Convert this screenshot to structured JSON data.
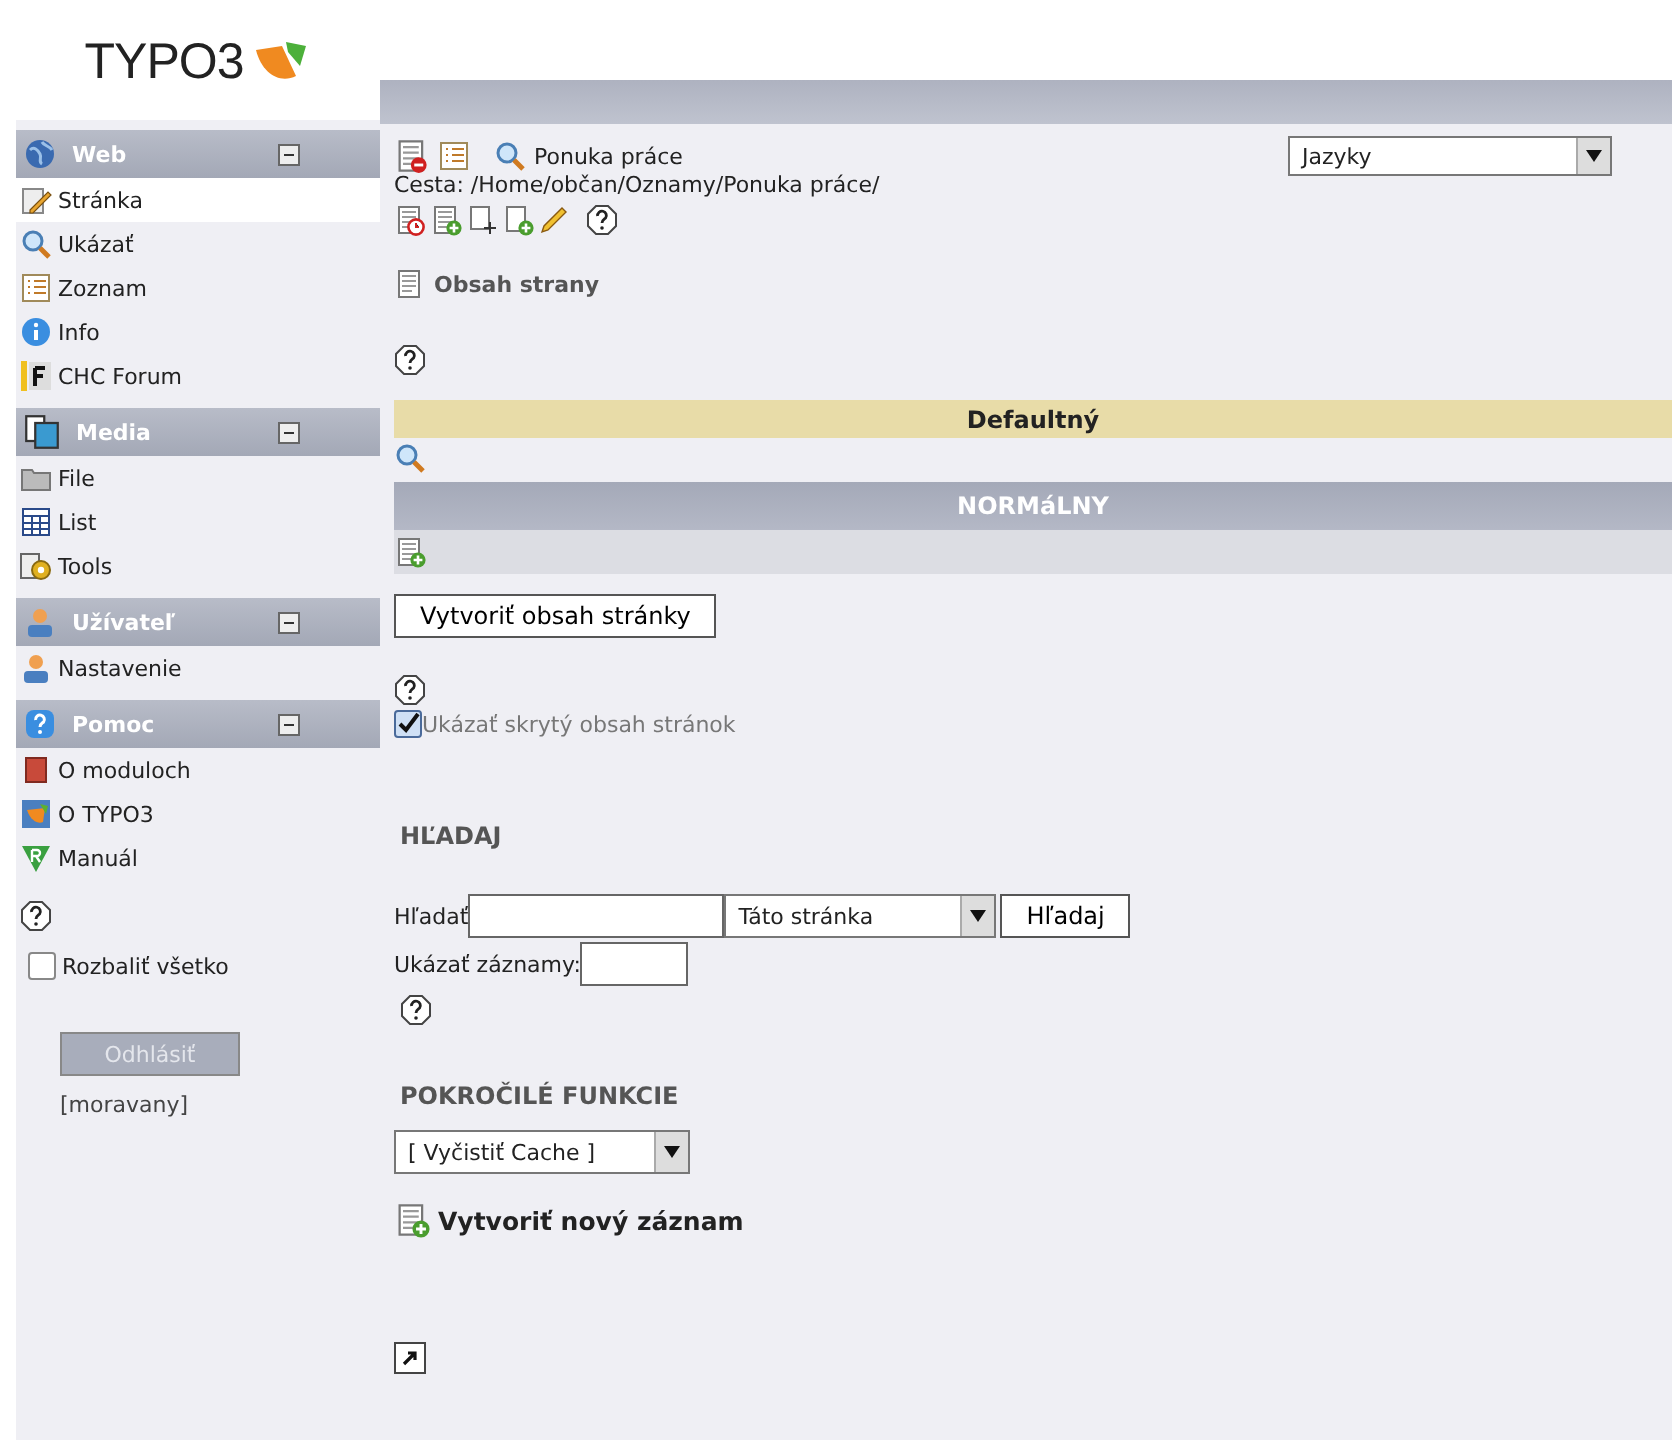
{
  "logo": {
    "text": "TYPO3"
  },
  "sidebar": {
    "groups": [
      {
        "title": "Web",
        "expanded": true,
        "items": [
          {
            "label": "Stránka",
            "selected": true
          },
          {
            "label": "Ukázať",
            "selected": false
          },
          {
            "label": "Zoznam",
            "selected": false
          },
          {
            "label": "Info",
            "selected": false
          },
          {
            "label": "CHC Forum",
            "selected": false
          }
        ]
      },
      {
        "title": "Media",
        "expanded": true,
        "items": [
          {
            "label": "File",
            "selected": false
          },
          {
            "label": "List",
            "selected": false
          },
          {
            "label": "Tools",
            "selected": false
          }
        ]
      },
      {
        "title": "Užívateľ",
        "expanded": true,
        "items": [
          {
            "label": "Nastavenie",
            "selected": false
          }
        ]
      },
      {
        "title": "Pomoc",
        "expanded": true,
        "items": [
          {
            "label": "O moduloch",
            "selected": false
          },
          {
            "label": "O TYPO3",
            "selected": false
          },
          {
            "label": "Manuál",
            "selected": false
          }
        ]
      }
    ],
    "expand_all": {
      "label": "Rozbaliť všetko",
      "checked": false
    },
    "logout_button": "Odhlásiť",
    "username": "[moravany]"
  },
  "main": {
    "page_title": "Ponuka práce",
    "language_select": "Jazyky",
    "path": "Cesta: /Home/občan/Oznamy/Ponuka práce/",
    "section_title": "Obsah strany",
    "language_bar": "Defaultný",
    "column_bar": "NORMáLNY",
    "create_content_button": "Vytvoriť obsah stránky",
    "show_hidden": {
      "label": "Ukázať skrytý obsah stránok",
      "checked": true
    },
    "search": {
      "title": "HĽADAJ",
      "label": "Hľadať",
      "scope_select": "Táto stránka",
      "button": "Hľadaj",
      "show_records_label": "Ukázať záznamy:"
    },
    "advanced": {
      "title": "POKROČILÉ FUNKCIE",
      "select": "[ Vyčistiť Cache ]"
    },
    "new_record_link": "Vytvoriť nový záznam"
  }
}
